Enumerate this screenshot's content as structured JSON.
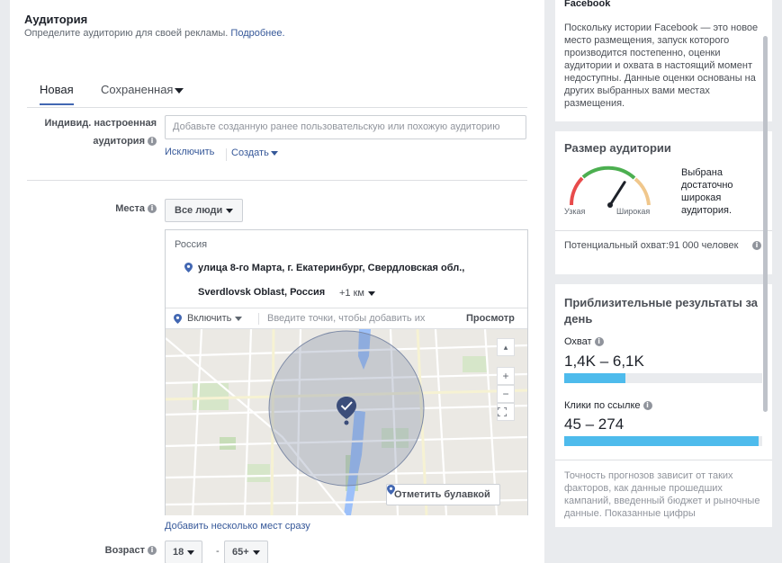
{
  "audience": {
    "title": "Аудитория",
    "subtitle": "Определите аудиторию для своей рекламы.",
    "learn_more": "Подробнее."
  },
  "tabs": [
    {
      "label": "Новая",
      "active": true
    },
    {
      "label": "Сохраненная",
      "active": false
    }
  ],
  "custom_audience": {
    "label_line1": "Индивид. настроенная",
    "label_line2": "аудитория",
    "placeholder": "Добавьте созданную ранее пользовательскую или похожую аудиторию",
    "exclude": "Исключить",
    "create": "Создать"
  },
  "locations": {
    "label": "Места",
    "who_dropdown": "Все люди",
    "country": "Россия",
    "address_line1": "улица 8-го Марта, г. Екатеринбург, Свердловская обл.,",
    "address_line2": "Sverdlovsk Oblast, Россия",
    "radius": "+1 км",
    "include_select": "Включить",
    "input_placeholder": "Введите точки, чтобы добавить их",
    "browse": "Просмотр",
    "drop_pin": "Отметить булавкой",
    "add_bulk": "Добавить несколько мест сразу",
    "zoom_in": "+",
    "zoom_out": "−",
    "accent_color": "#4267b2"
  },
  "age": {
    "label": "Возраст",
    "min": "18",
    "max": "65+",
    "separator": "-"
  },
  "sidebar": {
    "notice": {
      "heading": "Facebook",
      "text": "Поскольку истории Facebook — это новое место размещения, запуск которого производится постепенно, оценки аудитории и охвата в настоящий момент недоступны. Данные оценки основаны на других выбранных вами местах размещения."
    },
    "audience_size": {
      "title": "Размер аудитории",
      "narrow": "Узкая",
      "wide": "Широкая",
      "note": "Выбрана достаточно широкая аудитория.",
      "potential_reach": "Потенциальный охват:91 000 человек",
      "gauge_level": 0.68
    },
    "daily_results": {
      "title": "Приблизительные результаты за день",
      "reach_label": "Охват",
      "reach_value": "1,4K – 6,1K",
      "reach_fill": 0.31,
      "clicks_label": "Клики по ссылке",
      "clicks_value": "45 – 274",
      "clicks_fill": 0.98,
      "disclaimer": "Точность прогнозов зависит от таких факторов, как данные прошедших кампаний, введенный бюджет и рыночные данные. Показанные цифры",
      "bar_color": "#4ebbec"
    }
  }
}
